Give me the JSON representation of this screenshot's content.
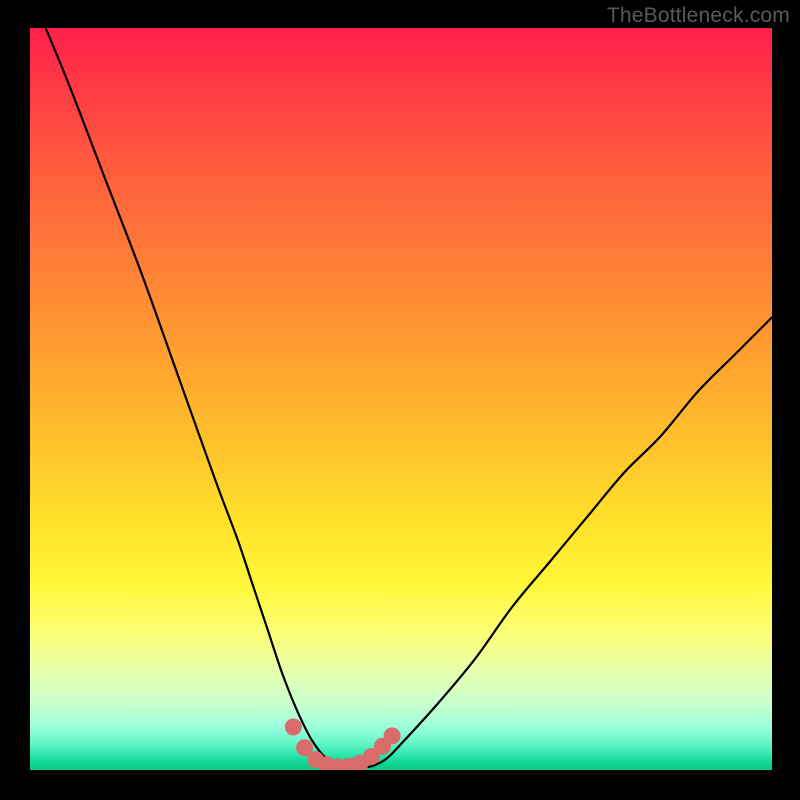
{
  "watermark": "TheBottleneck.com",
  "chart_data": {
    "type": "line",
    "title": "",
    "xlabel": "",
    "ylabel": "",
    "xlim": [
      0,
      100
    ],
    "ylim": [
      0,
      100
    ],
    "grid": false,
    "legend": false,
    "series": [
      {
        "name": "bottleneck-curve",
        "x": [
          0,
          5,
          10,
          15,
          20,
          25,
          28,
          30,
          32,
          34,
          36,
          38,
          40,
          42,
          44,
          46,
          48,
          50,
          55,
          60,
          65,
          70,
          75,
          80,
          85,
          90,
          95,
          100
        ],
        "y": [
          105,
          93,
          80,
          67,
          53,
          39,
          31,
          25,
          19,
          13,
          8,
          4,
          1.5,
          0.5,
          0.3,
          0.5,
          1.5,
          3.5,
          9,
          15,
          22,
          28,
          34,
          40,
          45,
          51,
          56,
          61
        ]
      }
    ],
    "markers": {
      "name": "trough-markers",
      "x": [
        35.5,
        37,
        38.5,
        40,
        41.5,
        43,
        44.5,
        46,
        47.5,
        48.8
      ],
      "y": [
        5.8,
        3.0,
        1.4,
        0.7,
        0.4,
        0.5,
        0.9,
        1.8,
        3.2,
        4.6
      ]
    },
    "background_gradient": {
      "top": "#ff1f4b",
      "mid": "#fff73a",
      "bottom": "#0bc985"
    }
  }
}
